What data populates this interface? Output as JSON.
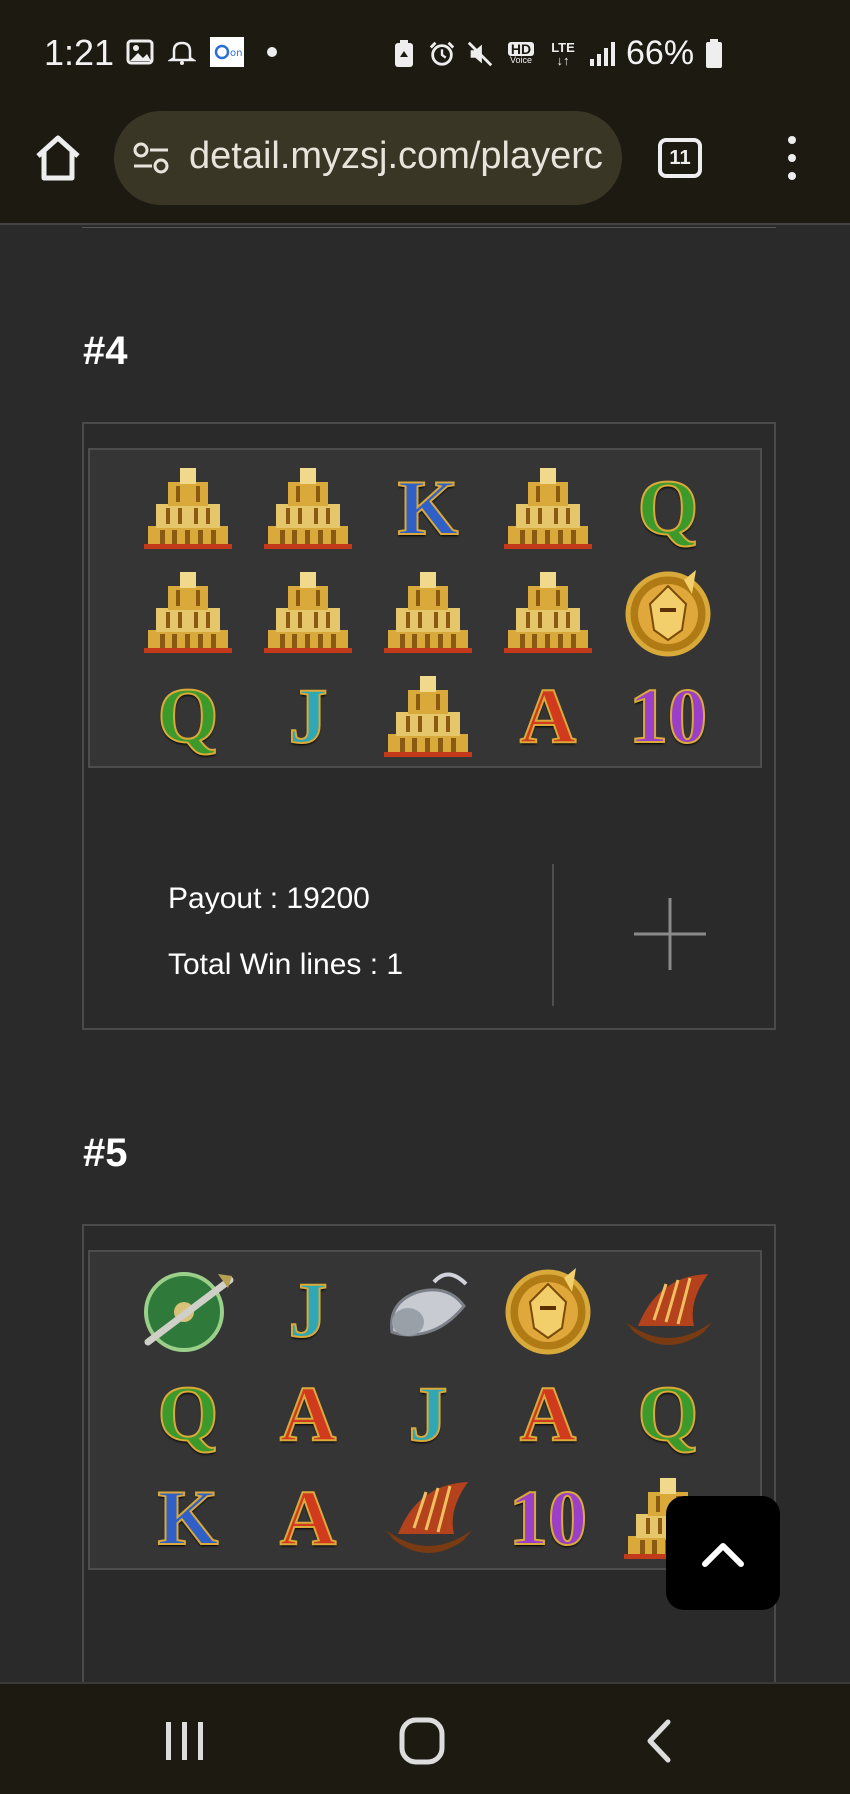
{
  "status_bar": {
    "time": "1:21",
    "battery": "66%",
    "icons_left": [
      "gallery-icon",
      "bell-icon",
      "app-badge-icon",
      "dot-icon"
    ],
    "icons_right": [
      "battery-saver-icon",
      "alarm-icon",
      "mute-icon",
      "hd-voice-icon",
      "lte-icon",
      "signal-icon",
      "battery-icon"
    ],
    "hd_label": "HD",
    "voice_label": "Voice",
    "lte_label": "LTE"
  },
  "browser": {
    "url": "detail.myzsj.com/playerc",
    "tab_count": "11"
  },
  "spins": [
    {
      "heading": "#4",
      "grid": [
        [
          "temple",
          "temple",
          "K",
          "temple",
          "Q"
        ],
        [
          "temple",
          "temple",
          "temple",
          "temple",
          "warrior"
        ],
        [
          "Q",
          "J",
          "temple",
          "A",
          "10"
        ]
      ],
      "payout_label": "Payout : 19200",
      "winlines_label": "Total Win lines : 1"
    },
    {
      "heading": "#5",
      "grid": [
        [
          "shield",
          "J",
          "horn",
          "warrior",
          "ship"
        ],
        [
          "Q",
          "A",
          "J",
          "A",
          "Q"
        ],
        [
          "K",
          "A",
          "ship",
          "10",
          "temple"
        ]
      ]
    }
  ],
  "colors": {
    "page_bg": "#2a2a2a",
    "chrome_bg": "#1d1a12",
    "omnibox_bg": "#3a3625",
    "K": "#2f5fc7",
    "Q": "#3c9a2a",
    "J": "#2fa7b5",
    "A": "#d23a1e",
    "10": "#9b3fc9",
    "gold": "#d9a93a"
  }
}
